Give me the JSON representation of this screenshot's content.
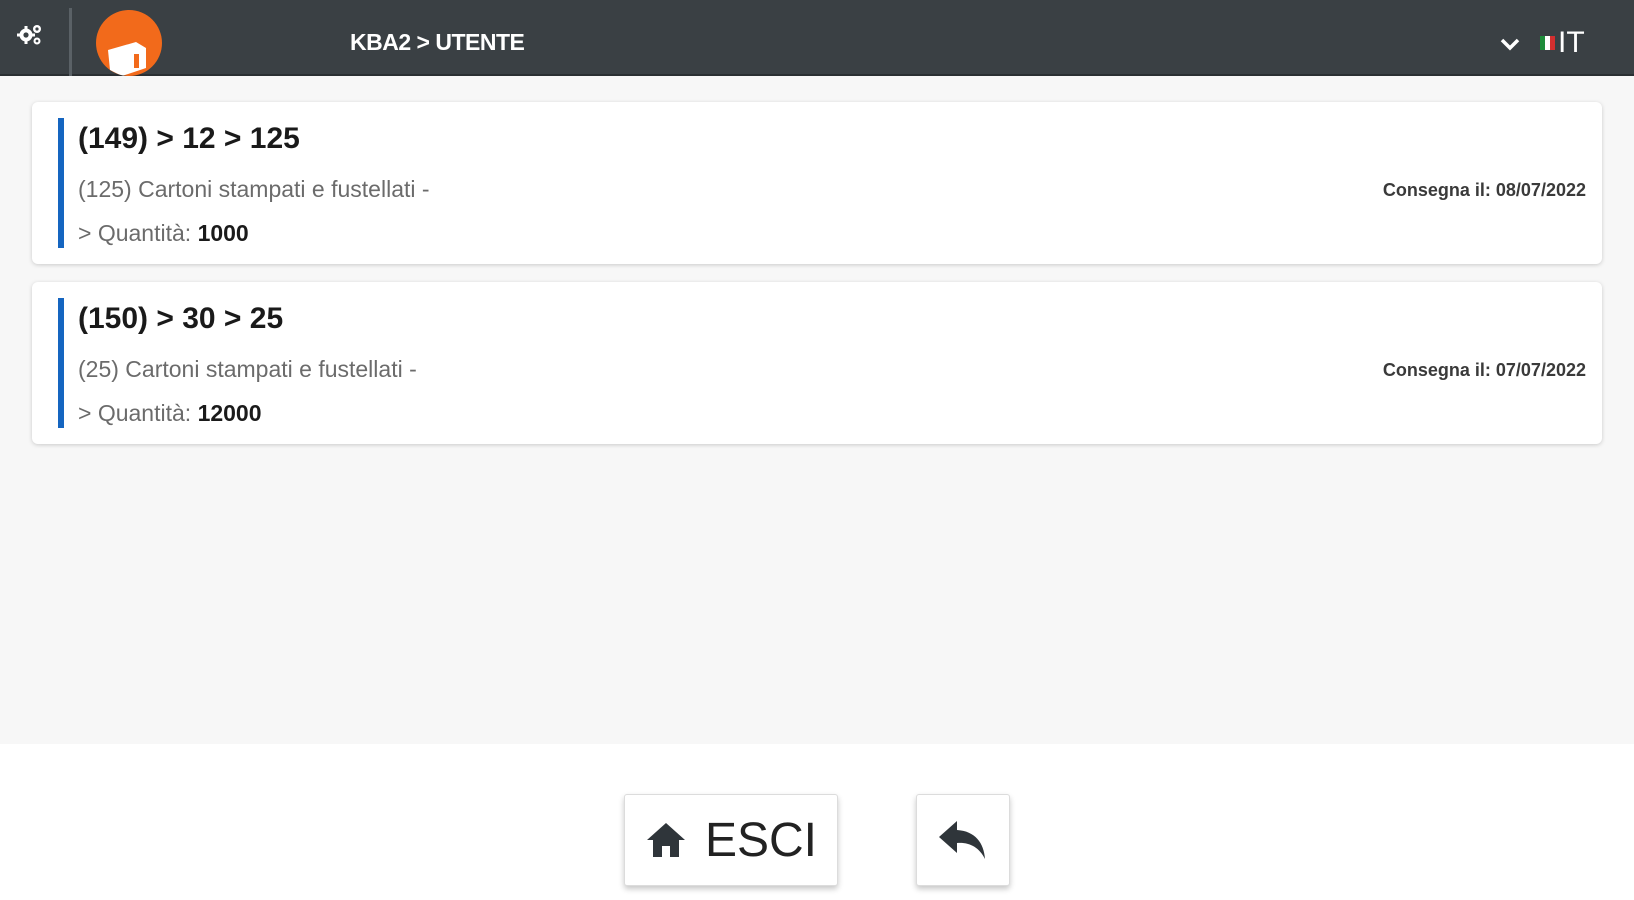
{
  "header": {
    "breadcrumb": "KBA2 > UTENTE",
    "language": "IT"
  },
  "orders": [
    {
      "title": "(149) > 12 > 125",
      "description": "(125) Cartoni stampati e fustellati -",
      "quantity_prefix": "> Quantità: ",
      "quantity": "1000",
      "delivery": "Consegna il: 08/07/2022"
    },
    {
      "title": "(150) > 30 > 25",
      "description": "(25) Cartoni stampati e fustellati -",
      "quantity_prefix": "> Quantità: ",
      "quantity": "12000",
      "delivery": "Consegna il: 07/07/2022"
    }
  ],
  "footer": {
    "exit_label": "ESCI"
  },
  "colors": {
    "topbar": "#3a4044",
    "accent": "#1565c0",
    "logo": "#f26a1b"
  },
  "icons": {
    "settings": "gears-icon",
    "logo": "logo-icon",
    "language_dropdown": "chevron-down-icon",
    "flag": "italy-flag-icon",
    "home": "home-icon",
    "back": "reply-arrow-icon"
  }
}
